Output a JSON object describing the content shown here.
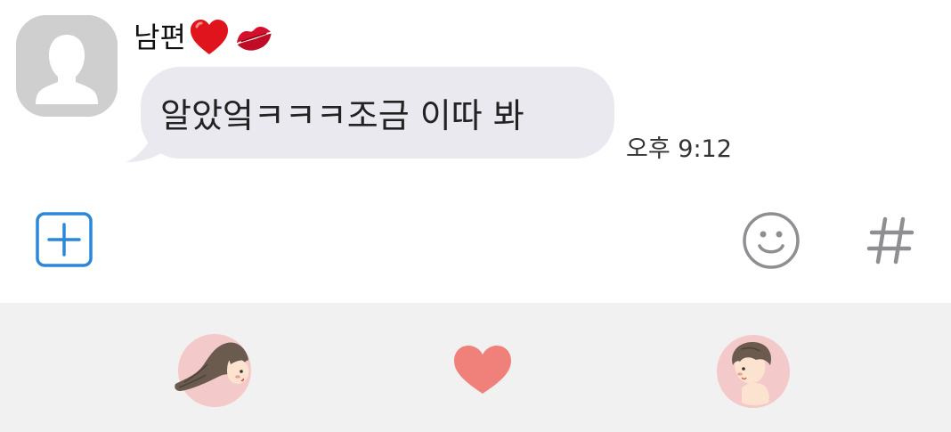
{
  "chat": {
    "sender_name": "남편",
    "sender_emojis": [
      "red-heart-icon",
      "kiss-mark-icon"
    ],
    "message_text": "알았엌ㅋㅋㅋ조금 이따 봐",
    "message_time": "오후 9:12"
  },
  "input_bar": {
    "left_icon": "add-plus-icon",
    "right_icons": [
      "emoji-smiley-icon",
      "hashtag-icon"
    ],
    "accent_color": "#2b88d8",
    "icon_color": "#8e8e93"
  },
  "sticker_tray": {
    "background": "#f1f1f1",
    "stickers": [
      "couple-girl-sticker",
      "heart-sticker",
      "couple-boy-sticker"
    ],
    "sticker_circle_color": "#f4c9c9",
    "heart_color": "#f0817a"
  },
  "colors": {
    "bubble_background": "#e9e9ef",
    "avatar_background": "#cfcfcf"
  }
}
